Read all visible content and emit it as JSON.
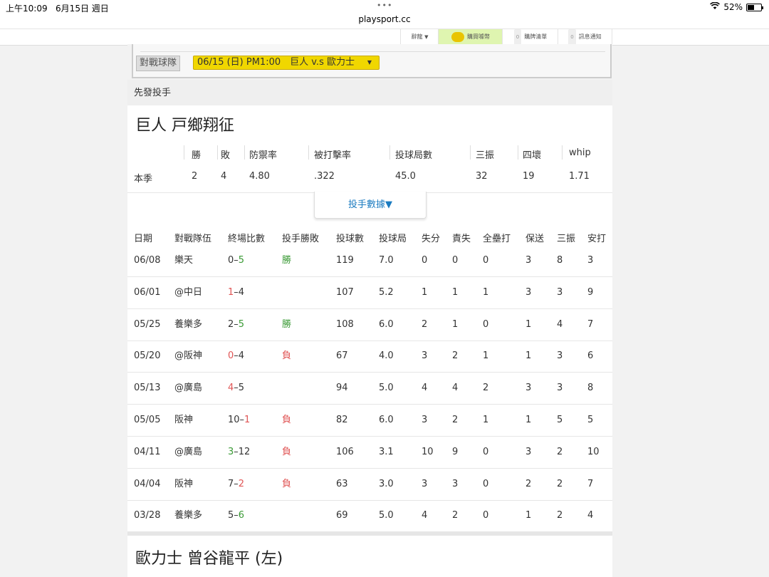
{
  "status_bar": {
    "time": "上午10:09",
    "date": "6月15日 週日",
    "url": "playsport.cc",
    "battery": "52%",
    "battery_level": 0.52
  },
  "top_nav": [
    {
      "label": "辭龍",
      "icon": "caret-down-icon"
    },
    {
      "label": "購買噱幣",
      "icon": "coin-icon"
    },
    {
      "label": "購牌清單",
      "badge": "0"
    },
    {
      "label": "訊息通知",
      "badge": "0"
    }
  ],
  "filter": {
    "label": "對戰球隊",
    "selected": "06/15 (日) PM1:00　巨人 v.s 歐力士"
  },
  "section_title": "先發投手",
  "pitcher": {
    "name": "巨人 戸鄉翔征",
    "season_headers": [
      "勝",
      "敗",
      "防禦率",
      "被打擊率",
      "投球局數",
      "三振",
      "四壞",
      "whip"
    ],
    "season_label": "本季",
    "season_values": [
      "2",
      "4",
      "4.80",
      ".322",
      "45.0",
      "32",
      "19",
      "1.71"
    ]
  },
  "toggle_label": "投手數據▼",
  "games_headers": [
    "日期",
    "對戰隊伍",
    "終場比數",
    "投手勝敗",
    "投球數",
    "投球局",
    "失分",
    "責失",
    "全壘打",
    "保送",
    "三振",
    "安打"
  ],
  "games": [
    {
      "date": "06/08",
      "opp": "樂天",
      "s1": "0",
      "s2": "5",
      "hl": 2,
      "dec": "勝",
      "dec_color": "green",
      "np": "119",
      "ip": "7.0",
      "r": "0",
      "er": "0",
      "hr": "0",
      "bb": "3",
      "so": "8",
      "h": "3"
    },
    {
      "date": "06/01",
      "opp": "@中日",
      "s1": "1",
      "s2": "4",
      "hl": 1,
      "dec": "",
      "dec_color": "",
      "np": "107",
      "ip": "5.2",
      "r": "1",
      "er": "1",
      "hr": "1",
      "bb": "3",
      "so": "3",
      "h": "9"
    },
    {
      "date": "05/25",
      "opp": "養樂多",
      "s1": "2",
      "s2": "5",
      "hl": 2,
      "dec": "勝",
      "dec_color": "green",
      "np": "108",
      "ip": "6.0",
      "r": "2",
      "er": "1",
      "hr": "0",
      "bb": "1",
      "so": "4",
      "h": "7"
    },
    {
      "date": "05/20",
      "opp": "@阪神",
      "s1": "0",
      "s2": "4",
      "hl": 1,
      "dec": "負",
      "dec_color": "red",
      "np": "67",
      "ip": "4.0",
      "r": "3",
      "er": "2",
      "hr": "1",
      "bb": "1",
      "so": "3",
      "h": "6"
    },
    {
      "date": "05/13",
      "opp": "@廣島",
      "s1": "4",
      "s2": "5",
      "hl": 1,
      "dec": "",
      "dec_color": "",
      "np": "94",
      "ip": "5.0",
      "r": "4",
      "er": "4",
      "hr": "2",
      "bb": "3",
      "so": "3",
      "h": "8"
    },
    {
      "date": "05/05",
      "opp": "阪神",
      "s1": "10",
      "s2": "1",
      "hl": 2,
      "dec": "負",
      "dec_color": "red",
      "np": "82",
      "ip": "6.0",
      "r": "3",
      "er": "2",
      "hr": "1",
      "bb": "1",
      "so": "5",
      "h": "5"
    },
    {
      "date": "04/11",
      "opp": "@廣島",
      "s1": "3",
      "s2": "12",
      "hl": 1,
      "dec": "負",
      "dec_color": "red",
      "np": "106",
      "ip": "3.1",
      "r": "10",
      "er": "9",
      "hr": "0",
      "bb": "3",
      "so": "2",
      "h": "10"
    },
    {
      "date": "04/04",
      "opp": "阪神",
      "s1": "7",
      "s2": "2",
      "hl": 2,
      "dec": "負",
      "dec_color": "red",
      "np": "63",
      "ip": "3.0",
      "r": "3",
      "er": "3",
      "hr": "0",
      "bb": "2",
      "so": "2",
      "h": "7"
    },
    {
      "date": "03/28",
      "opp": "養樂多",
      "s1": "5",
      "s2": "6",
      "hl": 2,
      "dec": "",
      "dec_color": "",
      "np": "69",
      "ip": "5.0",
      "r": "4",
      "er": "2",
      "hr": "0",
      "bb": "1",
      "so": "2",
      "h": "4"
    }
  ],
  "colors": {
    "win": "#3a9a35",
    "loss": "#e05555",
    "select_bg": "#f0d700",
    "link": "#1a7bc0"
  },
  "next_pitcher": {
    "name": "歐力士 曾谷龍平 (左)"
  }
}
